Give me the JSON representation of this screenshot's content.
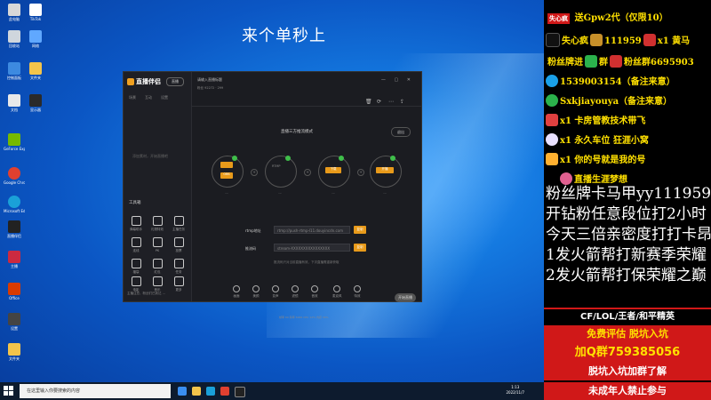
{
  "overlay_title": "来个单秒上",
  "colors": {
    "accent": "#e89a1a",
    "green": "#3fbf4a",
    "yellow": "#ffe000",
    "red_strip": "#d01818"
  },
  "desktop_icons": [
    {
      "label": "此电脑",
      "color": "#d8d8d8"
    },
    {
      "label": "TikTok",
      "color": "#ffffff"
    },
    {
      "label": "回收站",
      "color": "#cfd6dd"
    },
    {
      "label": "网络",
      "color": "#60a8ff"
    },
    {
      "label": "控制面板",
      "color": "#3d8ae0"
    },
    {
      "label": "GeForce Experience",
      "color": "#76b900"
    },
    {
      "label": "Google Chrome",
      "color": "#e04030"
    },
    {
      "label": "Microsoft Edge",
      "color": "#1aa0d8"
    },
    {
      "label": "直播伴侣",
      "color": "#222222"
    },
    {
      "label": "主播",
      "color": "#cc2a40"
    },
    {
      "label": "Office",
      "color": "#d83b01"
    },
    {
      "label": "设置",
      "color": "#444444"
    },
    {
      "label": "文件夹",
      "color": "#f3c44b"
    },
    {
      "label": "文档",
      "color": "#e9e9e9"
    },
    {
      "label": "文件",
      "color": "#f3c44b"
    },
    {
      "label": "文件夹",
      "color": "#f3c44b"
    },
    {
      "label": "显示器",
      "color": "#2a2a2a"
    }
  ],
  "taskbar": {
    "search_placeholder": "在这里输入你要搜索的内容",
    "time": "1:13",
    "date": "2022/11/7"
  },
  "app": {
    "logo": "直播伴侣",
    "pill": "直播",
    "side_tabs": [
      "场景",
      "互动",
      "设置"
    ],
    "side_hint": "添加素材，开始直播吧",
    "tools_header": "工具箱",
    "tools": [
      "弹幕助手",
      "礼物特效",
      "主播任务",
      "连线",
      "PK",
      "投票",
      "福袋",
      "红包",
      "任务",
      "电影",
      "音乐",
      "更多"
    ],
    "bottom_notice": "主播注意，粉丝们已到达 ...",
    "top_line": "请输入直播标题",
    "top_sub": "粉丝 92272 · 299",
    "mode_title": "直播三方推流模式",
    "exit": "退出",
    "steps": [
      "OBS",
      "RTMP",
      "下载",
      "开播"
    ],
    "fields": [
      {
        "label": "rtmp地址",
        "value": "rtmp://push-rtmp-l11.douyincdn.com",
        "btn": "复制"
      },
      {
        "label": "推流码",
        "value": "stream-XXXXXXXXXXXXXXXX",
        "btn": "复制"
      }
    ],
    "field_hint": "推流码只对当前直播有效，下次直播需重新获取",
    "bottom_tools": [
      "画面",
      "美颜",
      "变声",
      "滤镜",
      "音效",
      "麦克风",
      "特效"
    ],
    "go_live": "开始直播",
    "stats": "帧率 60 码率 6000 CPU 12% 内存 30%"
  },
  "panel": {
    "row1": "送Gpw2代（仅限10）",
    "row1_tag": "失心疯",
    "row2_prefix": "失心疯",
    "row2_code": "111959",
    "row2_tail": "x1 黄马",
    "row3": "粉丝牌进",
    "row3_mid": "群",
    "row3_tail": "粉丝群6695903",
    "row4": "1539003154（备注来意）",
    "row5": "Sxkjiayouya（备注来意）",
    "row6": "x1 卡房管教技术带飞",
    "row7": "x1 永久车位 狂涯小窝",
    "row8": "x1 你的号就是我的号",
    "row9": "直播生涯梦想",
    "big_lines": [
      "粉丝牌卡马甲yy111959",
      "开钻粉任意段位打2小时",
      "今天三倍亲密度打打卡昂",
      "1发火箭帮打新赛季荣耀",
      "2发火箭帮打保荣耀之巅"
    ],
    "strip1": "CF/LOL/王者/和平精英",
    "strip2": "免费评估 脱坑入坑",
    "strip3": "加Q群759385056",
    "strip4": "脱坑入坑加群了解",
    "strip5": "未成年人禁止参与"
  }
}
